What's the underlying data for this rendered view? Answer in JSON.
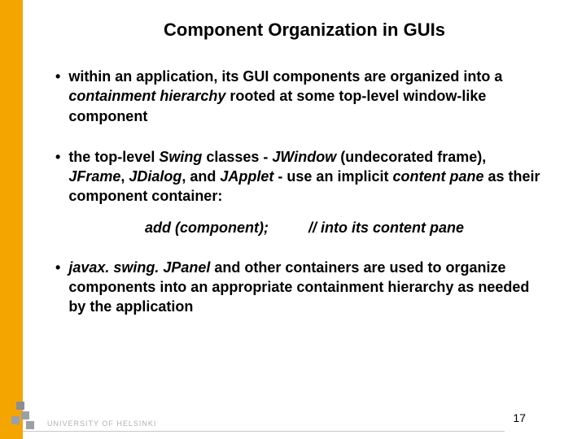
{
  "title": "Component Organization in GUIs",
  "bullets": {
    "b1": "within an application, its GUI components are organized into a <i>containment hierarchy</i> rooted at some top-level window-like component",
    "b2": "the top-level <i>Swing</i> classes - <i>JWindow</i> (undecorated frame), <i>JFrame</i>, <i>JDialog</i>, and <i>JApplet</i> - use an implicit <i>content pane</i> as their component container:",
    "b3": "<i>javax. swing. JPanel</i> and other containers are used to organize components into an appropriate containment hierarchy as needed by the application"
  },
  "codeline": {
    "call": "add (component);",
    "comment": "// into its content pane"
  },
  "footer": {
    "university": "UNIVERSITY OF HELSINKI",
    "page": "17"
  }
}
